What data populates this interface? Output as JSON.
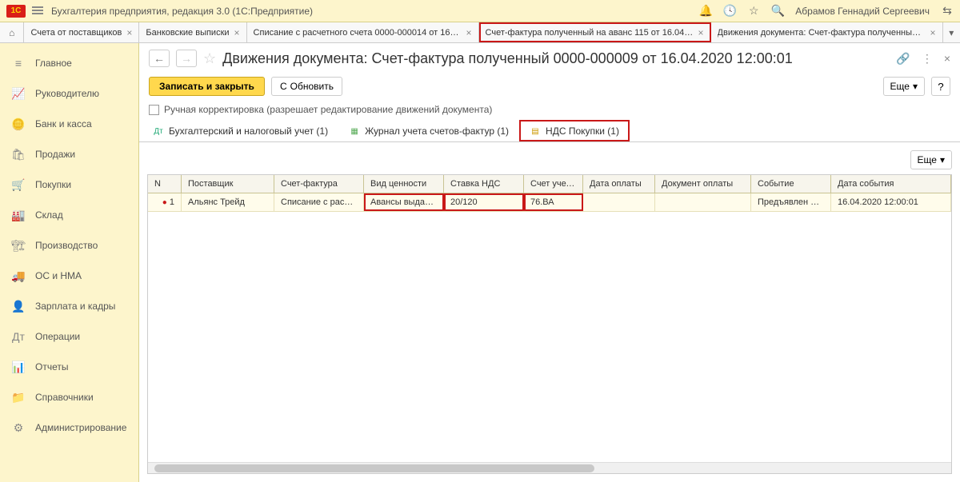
{
  "titlebar": {
    "product": "Бухгалтерия предприятия, редакция 3.0  (1С:Предприятие)",
    "user": "Абрамов Геннадий Сергеевич"
  },
  "tabs": [
    {
      "label": "Счета от поставщиков"
    },
    {
      "label": "Банковские выписки"
    },
    {
      "label": "Списание с расчетного счета 0000-000014 от 16.0..."
    },
    {
      "label": "Счет-фактура полученный на аванс 115 от 16.04.2..."
    },
    {
      "label": "Движения документа: Счет-фактура полученный 0..."
    }
  ],
  "sidebar": {
    "items": [
      {
        "label": "Главное",
        "glyph": "≡"
      },
      {
        "label": "Руководителю",
        "glyph": "📈"
      },
      {
        "label": "Банк и касса",
        "glyph": "🪙"
      },
      {
        "label": "Продажи",
        "glyph": "🛍"
      },
      {
        "label": "Покупки",
        "glyph": "🛒"
      },
      {
        "label": "Склад",
        "glyph": "🏭"
      },
      {
        "label": "Производство",
        "glyph": "🏗"
      },
      {
        "label": "ОС и НМА",
        "glyph": "🚚"
      },
      {
        "label": "Зарплата и кадры",
        "glyph": "👤"
      },
      {
        "label": "Операции",
        "glyph": "Дт"
      },
      {
        "label": "Отчеты",
        "glyph": "📊"
      },
      {
        "label": "Справочники",
        "glyph": "📁"
      },
      {
        "label": "Администрирование",
        "glyph": "⚙"
      }
    ]
  },
  "page": {
    "title": "Движения документа: Счет-фактура полученный 0000-000009 от 16.04.2020 12:00:01",
    "save_close": "Записать и закрыть",
    "refresh": "Обновить",
    "more": "Еще",
    "help": "?",
    "checkbox_label": "Ручная корректировка (разрешает редактирование движений документа)"
  },
  "inner_tabs": [
    {
      "label": "Бухгалтерский и налоговый учет (1)"
    },
    {
      "label": "Журнал учета счетов-фактур (1)"
    },
    {
      "label": "НДС Покупки (1)"
    }
  ],
  "table": {
    "more": "Еще",
    "headers": {
      "n": "N",
      "supplier": "Поставщик",
      "invoice": "Счет-фактура",
      "valtype": "Вид ценности",
      "vat": "Ставка НДС",
      "acc": "Счет учет...",
      "paydate": "Дата оплаты",
      "paydoc": "Документ оплаты",
      "event": "Событие",
      "edate": "Дата события"
    },
    "rows": [
      {
        "n": "1",
        "supplier": "Альянс Трейд",
        "invoice": "Списание с расче...",
        "valtype": "Авансы выдан...",
        "vat": "20/120",
        "acc": "76.ВА",
        "paydate": "",
        "paydoc": "",
        "event": "Предъявлен Н...",
        "edate": "16.04.2020 12:00:01"
      }
    ]
  }
}
